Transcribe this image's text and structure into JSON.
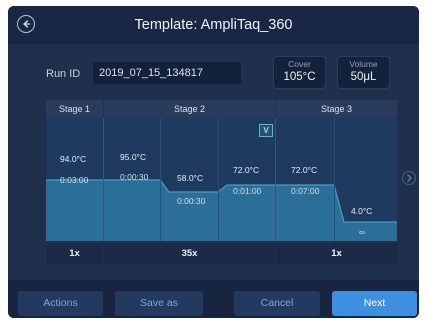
{
  "header": {
    "title": "Template: AmpliTaq_360",
    "back_icon": "back-arrow-icon"
  },
  "run": {
    "label": "Run ID",
    "value": "2019_07_15_134817"
  },
  "cover": {
    "label": "Cover",
    "value": "105°C"
  },
  "volume": {
    "label": "Volume",
    "value": "50μL"
  },
  "stages": [
    {
      "label": "Stage 1",
      "cycles": "1x"
    },
    {
      "label": "Stage 2",
      "cycles": "35x"
    },
    {
      "label": "Stage 3",
      "cycles": "1x"
    }
  ],
  "steps": [
    {
      "temp": "94.0°C",
      "time": "0:03:00"
    },
    {
      "temp": "95.0°C",
      "time": "0:00:30"
    },
    {
      "temp": "58.0°C",
      "time": "0:00:30"
    },
    {
      "temp": "72.0°C",
      "time": "0:01:00"
    },
    {
      "temp": "72.0°C",
      "time": "0:07:00"
    },
    {
      "temp": "4.0°C",
      "time": "∞"
    }
  ],
  "badge": "V",
  "colors": {
    "background": "#1f2f4c",
    "profile_fill": "#2a6f97",
    "primary_button": "#3d8fe0",
    "badge_accent": "#4fc3c0"
  },
  "footer": {
    "actions": "Actions",
    "save_as": "Save as",
    "cancel": "Cancel",
    "next": "Next"
  }
}
